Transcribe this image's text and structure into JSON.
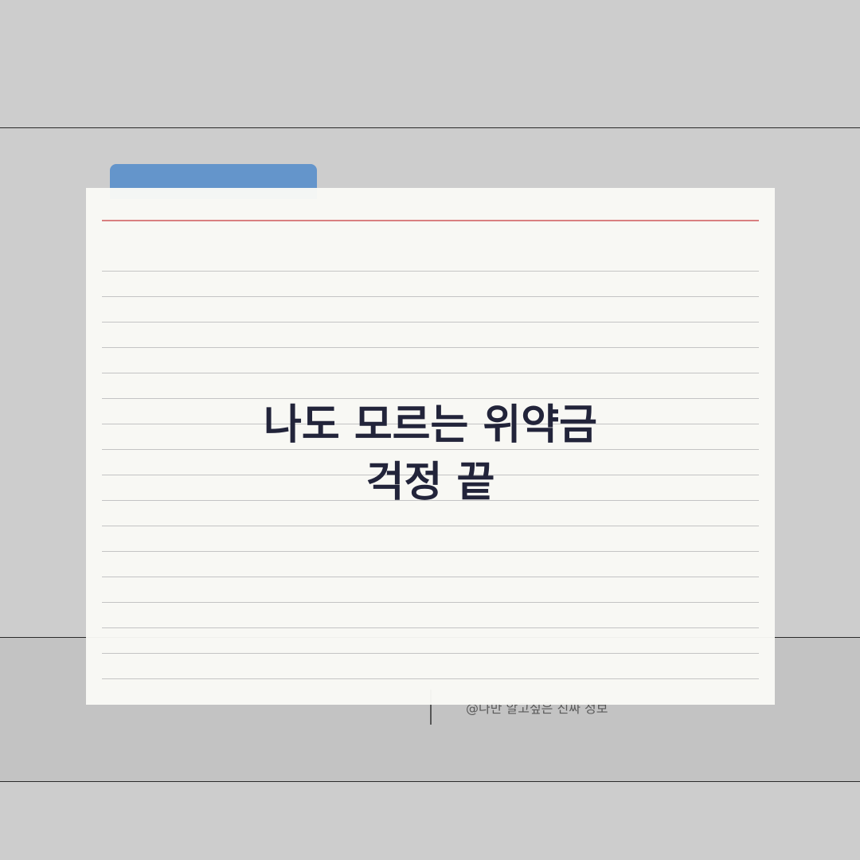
{
  "card": {
    "headline_line1": "나도 모르는 위약금",
    "headline_line2": "걱정 끝"
  },
  "footer": {
    "credit": "@나만 알고싶은 진짜 정보"
  },
  "colors": {
    "background": "#cdcdcd",
    "footer_band": "#c3c3c3",
    "tab": "#6495cb",
    "card": "#fafaf6",
    "header_rule": "#d98080",
    "headline_text": "#22243a"
  }
}
